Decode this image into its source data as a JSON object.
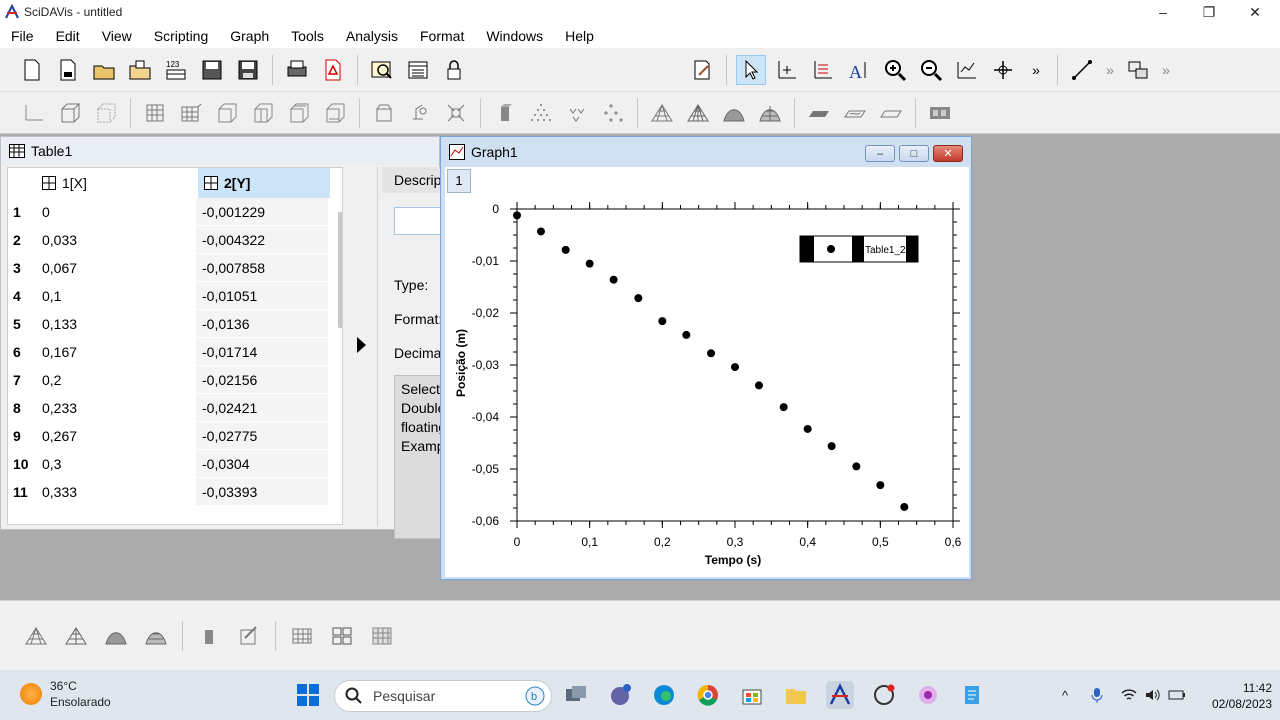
{
  "window": {
    "title": "SciDAVis - untitled"
  },
  "menu": [
    "File",
    "Edit",
    "View",
    "Scripting",
    "Graph",
    "Tools",
    "Analysis",
    "Format",
    "Windows",
    "Help"
  ],
  "table_window": {
    "title": "Table1",
    "columns": [
      "1[X]",
      "2[Y]"
    ],
    "rows": [
      {
        "n": "1",
        "x": "0",
        "y": "-0,001229"
      },
      {
        "n": "2",
        "x": "0,033",
        "y": "-0,004322"
      },
      {
        "n": "3",
        "x": "0,067",
        "y": "-0,007858"
      },
      {
        "n": "4",
        "x": "0,1",
        "y": "-0,01051"
      },
      {
        "n": "5",
        "x": "0,133",
        "y": "-0,0136"
      },
      {
        "n": "6",
        "x": "0,167",
        "y": "-0,01714"
      },
      {
        "n": "7",
        "x": "0,2",
        "y": "-0,02156"
      },
      {
        "n": "8",
        "x": "0,233",
        "y": "-0,02421"
      },
      {
        "n": "9",
        "x": "0,267",
        "y": "-0,02775"
      },
      {
        "n": "10",
        "x": "0,3",
        "y": "-0,0304"
      },
      {
        "n": "11",
        "x": "0,333",
        "y": "-0,03393"
      }
    ],
    "desc_panel": {
      "tab": "Description",
      "type_label": "Type:",
      "format_label": "Format:",
      "decimal_label": "Decimals:",
      "info_lines": [
        "Selected",
        "Double",
        "floating",
        "Example"
      ]
    }
  },
  "graph_window": {
    "title": "Graph1",
    "layer": "1",
    "legend_text": "Table1_2",
    "chart_data": {
      "type": "scatter",
      "xlabel": "Tempo (s)",
      "ylabel": "Posição (m)",
      "xlim": [
        0,
        0.6
      ],
      "ylim": [
        -0.06,
        0
      ],
      "x_ticks": [
        "0",
        "0,1",
        "0,2",
        "0,3",
        "0,4",
        "0,5",
        "0,6"
      ],
      "y_ticks": [
        "0",
        "-0,01",
        "-0,02",
        "-0,03",
        "-0,04",
        "-0,05",
        "-0,06"
      ],
      "series": [
        {
          "name": "Table1_2",
          "x": [
            0,
            0.033,
            0.067,
            0.1,
            0.133,
            0.167,
            0.2,
            0.233,
            0.267,
            0.3,
            0.333,
            0.367,
            0.4,
            0.433,
            0.467,
            0.5,
            0.533
          ],
          "y": [
            -0.001229,
            -0.004322,
            -0.007858,
            -0.01051,
            -0.0136,
            -0.01714,
            -0.02156,
            -0.02421,
            -0.02775,
            -0.0304,
            -0.03393,
            -0.0381,
            -0.0423,
            -0.0456,
            -0.0495,
            -0.0531,
            -0.0573
          ]
        }
      ],
      "grid": false,
      "legend_position": "top-right"
    }
  },
  "taskbar": {
    "weather_temp": "36°C",
    "weather_desc": "Ensolarado",
    "search_placeholder": "Pesquisar",
    "time": "11:42",
    "date": "02/08/2023"
  }
}
